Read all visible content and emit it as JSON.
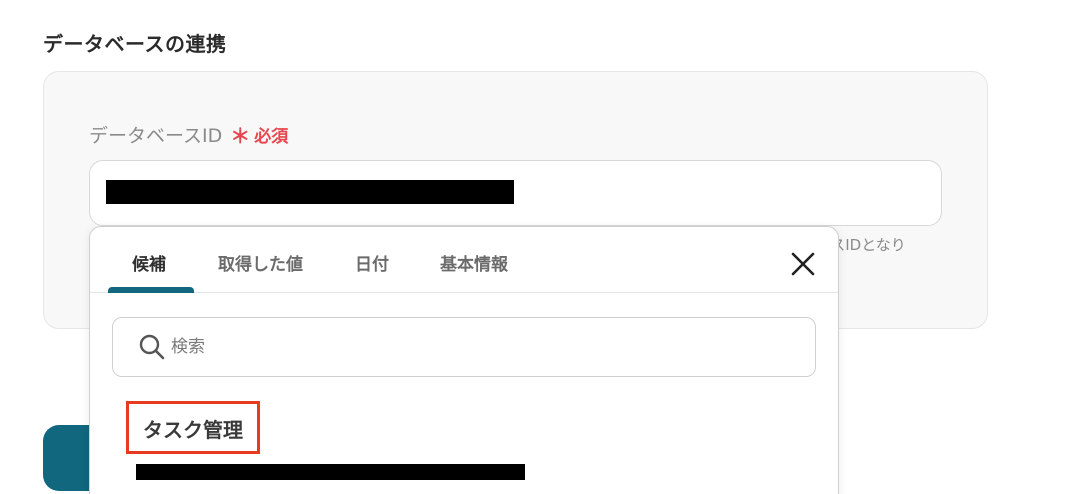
{
  "section": {
    "title": "データベースの連携"
  },
  "field": {
    "label": "データベースID",
    "required_mark": "＊",
    "required_text": "必須",
    "value": "",
    "helper_text": "ースIDとなり"
  },
  "popup": {
    "tabs": [
      {
        "label": "候補",
        "active": true
      },
      {
        "label": "取得した値",
        "active": false
      },
      {
        "label": "日付",
        "active": false
      },
      {
        "label": "基本情報",
        "active": false
      }
    ],
    "close_icon": "close-icon",
    "search": {
      "placeholder": "検索",
      "value": "",
      "icon": "search-icon"
    },
    "results": [
      {
        "title": "タスク管理",
        "subtitle": ""
      }
    ]
  },
  "colors": {
    "accent": "#11677d",
    "required": "#e8464f",
    "highlight_border": "#e83a20",
    "card_bg": "#f8f8f8"
  }
}
